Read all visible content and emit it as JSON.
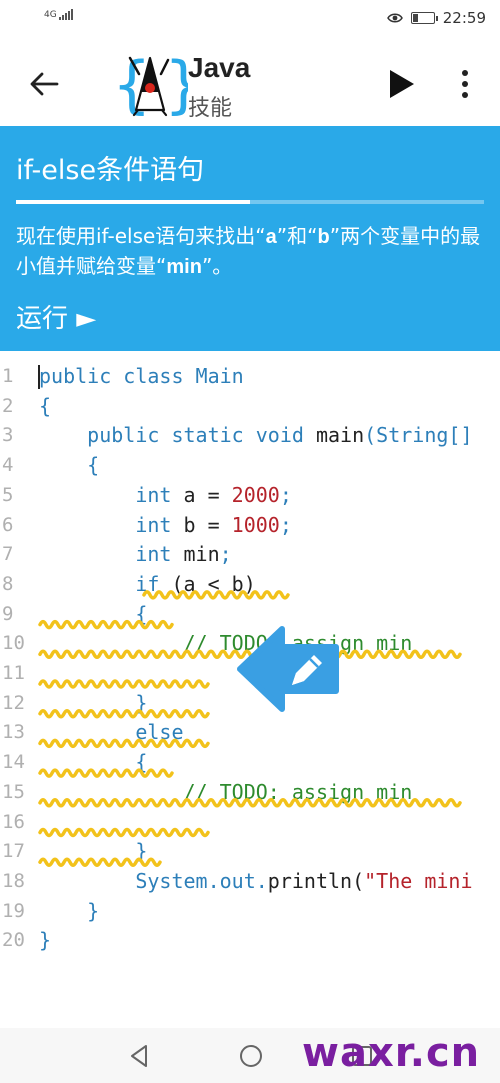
{
  "status_bar": {
    "network": "4G",
    "time": "22:59",
    "battery_level": 0.35
  },
  "toolbar": {
    "app_name": "Java",
    "app_subname": "技能",
    "icons": [
      "back-arrow-icon",
      "java-duke-logo",
      "play-icon",
      "more-vert-icon"
    ]
  },
  "lesson": {
    "title": "if-else条件语句",
    "progress": 0.5,
    "description_parts": [
      "现在使用if-else语句来找出“",
      "a",
      "”和“",
      "b",
      "”两个变量中的最小值并赋给变量“",
      "min",
      "”。"
    ],
    "run_label": "运行 ►"
  },
  "code": {
    "lines": [
      {
        "no": "1",
        "tokens": [
          {
            "t": "public class ",
            "c": "kw"
          },
          {
            "t": "Main",
            "c": "cls"
          }
        ]
      },
      {
        "no": "2",
        "tokens": [
          {
            "t": "{",
            "c": "kw"
          }
        ]
      },
      {
        "no": "3",
        "tokens": [
          {
            "t": "    public static ",
            "c": "kw"
          },
          {
            "t": "void ",
            "c": "kw"
          },
          {
            "t": "main",
            "c": ""
          },
          {
            "t": "(String[]",
            "c": "kw"
          }
        ]
      },
      {
        "no": "4",
        "tokens": [
          {
            "t": "    {",
            "c": "kw"
          }
        ]
      },
      {
        "no": "5",
        "tokens": [
          {
            "t": "        int ",
            "c": "kw"
          },
          {
            "t": "a = ",
            "c": ""
          },
          {
            "t": "2000",
            "c": "num"
          },
          {
            "t": ";",
            "c": "kw"
          }
        ]
      },
      {
        "no": "6",
        "tokens": [
          {
            "t": "        int ",
            "c": "kw"
          },
          {
            "t": "b = ",
            "c": ""
          },
          {
            "t": "1000",
            "c": "num"
          },
          {
            "t": ";",
            "c": "kw"
          }
        ]
      },
      {
        "no": "7",
        "tokens": [
          {
            "t": "        int ",
            "c": "kw"
          },
          {
            "t": "min",
            "c": ""
          },
          {
            "t": ";",
            "c": "kw"
          }
        ]
      },
      {
        "no": "8",
        "tokens": [
          {
            "t": "        if ",
            "c": "kw"
          },
          {
            "t": "(a < b)",
            "c": ""
          }
        ]
      },
      {
        "no": "9",
        "tokens": [
          {
            "t": "        {",
            "c": "kw"
          }
        ]
      },
      {
        "no": "10",
        "tokens": [
          {
            "t": "            // TODO: assign min",
            "c": "cmt"
          }
        ]
      },
      {
        "no": "11",
        "tokens": []
      },
      {
        "no": "12",
        "tokens": [
          {
            "t": "        }",
            "c": "kw"
          }
        ]
      },
      {
        "no": "13",
        "tokens": [
          {
            "t": "        else",
            "c": "kw"
          }
        ]
      },
      {
        "no": "14",
        "tokens": [
          {
            "t": "        {",
            "c": "kw"
          }
        ]
      },
      {
        "no": "15",
        "tokens": [
          {
            "t": "            // TODO: assign min",
            "c": "cmt"
          }
        ]
      },
      {
        "no": "16",
        "tokens": []
      },
      {
        "no": "17",
        "tokens": [
          {
            "t": "        }",
            "c": "kw"
          }
        ]
      },
      {
        "no": "18",
        "tokens": [
          {
            "t": "        System",
            "c": "cls"
          },
          {
            "t": ".",
            "c": "kw"
          },
          {
            "t": "out",
            "c": "cls"
          },
          {
            "t": ".",
            "c": "kw"
          },
          {
            "t": "println(",
            "c": ""
          },
          {
            "t": "\"The mini",
            "c": "str"
          }
        ]
      },
      {
        "no": "19",
        "tokens": [
          {
            "t": "    }",
            "c": "kw"
          }
        ]
      },
      {
        "no": "20",
        "tokens": [
          {
            "t": "}",
            "c": "kw"
          }
        ]
      }
    ]
  },
  "watermark": "waxr.cn",
  "colors": {
    "accent": "#2aa9e8",
    "keyword": "#2d7fb9",
    "number": "#b5232b",
    "comment": "#2e8b2e",
    "squiggle": "#f2c21b",
    "fab": "#3a9fe3",
    "watermark": "#7a1fa0"
  }
}
